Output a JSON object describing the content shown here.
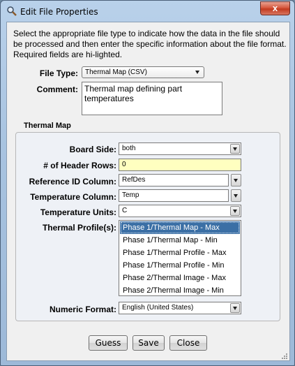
{
  "window": {
    "title": "Edit File Properties",
    "close_label": "x",
    "colors": {
      "frame": "#a8c3e0",
      "close": "#c23a1f",
      "selection": "#3b6fa5",
      "required_field": "#ffffc0"
    }
  },
  "intro_text": "Select the appropriate file type to indicate how the data in the file should be processed and then enter the specific information about the file format. Required fields are hi-lighted.",
  "file_type": {
    "label": "File Type:",
    "value": "Thermal Map (CSV)",
    "icon": "chevron-down-icon"
  },
  "comment": {
    "label": "Comment:",
    "value": "Thermal map defining part temperatures"
  },
  "group": {
    "title": "Thermal Map",
    "board_side": {
      "label": "Board Side:",
      "value": "both"
    },
    "header_rows": {
      "label": "# of Header Rows:",
      "value": "0"
    },
    "reference_id": {
      "label": "Reference ID Column:",
      "value": "RefDes"
    },
    "temperature_column": {
      "label": "Temperature Column:",
      "value": "Temp"
    },
    "temperature_units": {
      "label": "Temperature Units:",
      "value": "C"
    },
    "thermal_profiles": {
      "label": "Thermal Profile(s):",
      "items": [
        "Phase 1/Thermal Map - Max",
        "Phase 1/Thermal Map - Min",
        "Phase 1/Thermal Profile - Max",
        "Phase 1/Thermal Profile - Min",
        "Phase 2/Thermal Image - Max",
        "Phase 2/Thermal Image - Min"
      ],
      "selected": "Phase 1/Thermal Map - Max"
    },
    "numeric_format": {
      "label": "Numeric Format:",
      "value": "English (United States)"
    }
  },
  "buttons": {
    "guess": "Guess",
    "save": "Save",
    "close": "Close"
  }
}
